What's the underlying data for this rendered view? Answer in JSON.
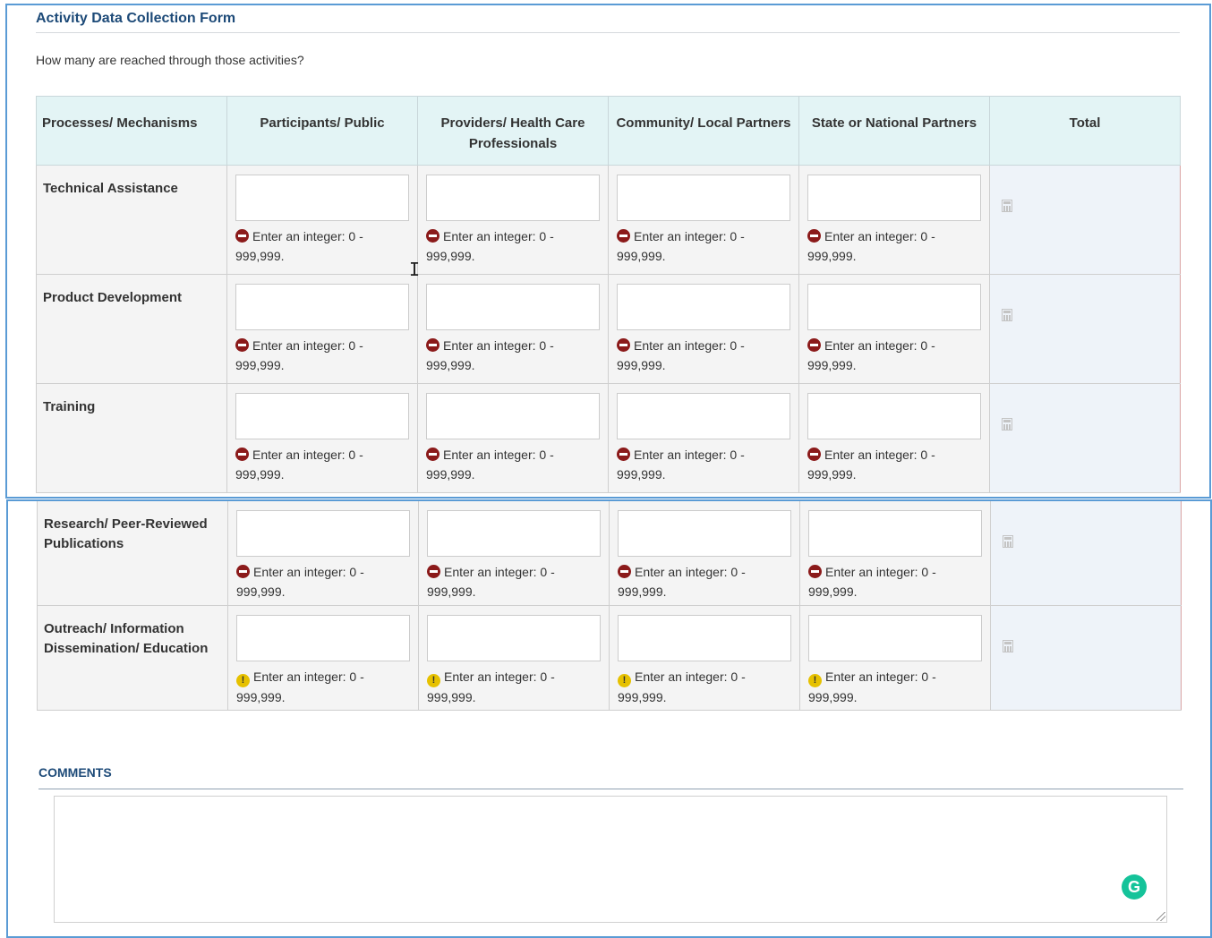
{
  "form": {
    "title": "Activity Data Collection Form",
    "question": "How many are reached through those activities?"
  },
  "table": {
    "headers": {
      "mechanisms": "Processes/ Mechanisms",
      "participants": "Participants/ Public",
      "providers": "Providers/ Health Care Professionals",
      "community": "Community/ Local Partners",
      "state": "State or National Partners",
      "total": "Total"
    },
    "rows": [
      {
        "label": "Technical Assistance",
        "status": "error"
      },
      {
        "label": "Product Development",
        "status": "error"
      },
      {
        "label": "Training",
        "status": "error"
      },
      {
        "label": "Research/ Peer-Reviewed Publications",
        "status": "error"
      },
      {
        "label": "Outreach/ Information Dissemination/ Education",
        "status": "warning"
      }
    ],
    "validation_line1": "Enter an integer: 0 -",
    "validation_line2": "999,999.",
    "total_icon": "calculator-icon"
  },
  "comments": {
    "title": "COMMENTS",
    "value": ""
  },
  "icons": {
    "error": "minus-circle-icon",
    "warning": "exclamation-circle-icon",
    "grammarly": "grammarly-icon",
    "grammarly_letter": "G"
  },
  "colors": {
    "header_bg": "#e3f4f5",
    "title_color": "#1d4a78",
    "error_icon": "#8b1a1a",
    "warning_icon": "#e6c100",
    "grammarly": "#15c39a",
    "panel_border": "#5a9bd5"
  }
}
